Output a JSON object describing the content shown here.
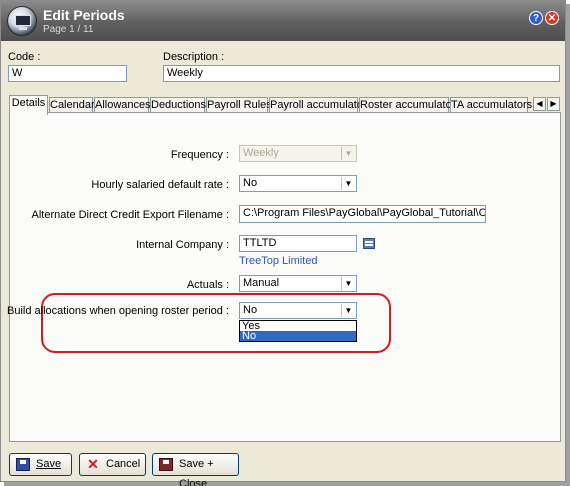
{
  "window": {
    "title": "Edit Periods",
    "subtitle": "Page 1 / 11",
    "help_icon": "?",
    "close_icon": "✕"
  },
  "header": {
    "code_label": "Code :",
    "code_value": "W",
    "description_label": "Description :",
    "description_value": "Weekly"
  },
  "tabs": [
    {
      "label": "Details",
      "active": true
    },
    {
      "label": "Calendar"
    },
    {
      "label": "Allowances"
    },
    {
      "label": "Deductions"
    },
    {
      "label": "Payroll Rules"
    },
    {
      "label": "Payroll accumulators"
    },
    {
      "label": "Roster accumulators"
    },
    {
      "label": "TA accumulators"
    }
  ],
  "tab_scroll": {
    "left": "◀",
    "right": "▶"
  },
  "form": {
    "frequency_label": "Frequency :",
    "frequency_value": "Weekly",
    "hourly_label": "Hourly salaried default rate :",
    "hourly_value": "No",
    "alt_dc_label": "Alternate Direct Credit Export Filename :",
    "alt_dc_value": "C:\\Program Files\\PayGlobal\\PayGlobal_Tutorial\\CompNZ\\",
    "internal_company_label": "Internal Company :",
    "internal_company_value": "TTLTD",
    "internal_company_name": "TreeTop Limited",
    "actuals_label": "Actuals :",
    "actuals_value": "Manual",
    "build_alloc_label": "Build allocations when opening roster period :",
    "build_alloc_value": "No",
    "build_alloc_options": [
      "Yes",
      "No"
    ],
    "dropdown_arrow": "▼"
  },
  "buttons": {
    "save": "Save",
    "cancel": "Cancel",
    "save_close": "Save + Close"
  },
  "colors": {
    "highlight": "#d41c1c",
    "link": "#2b55b8",
    "selection": "#316ac5"
  }
}
